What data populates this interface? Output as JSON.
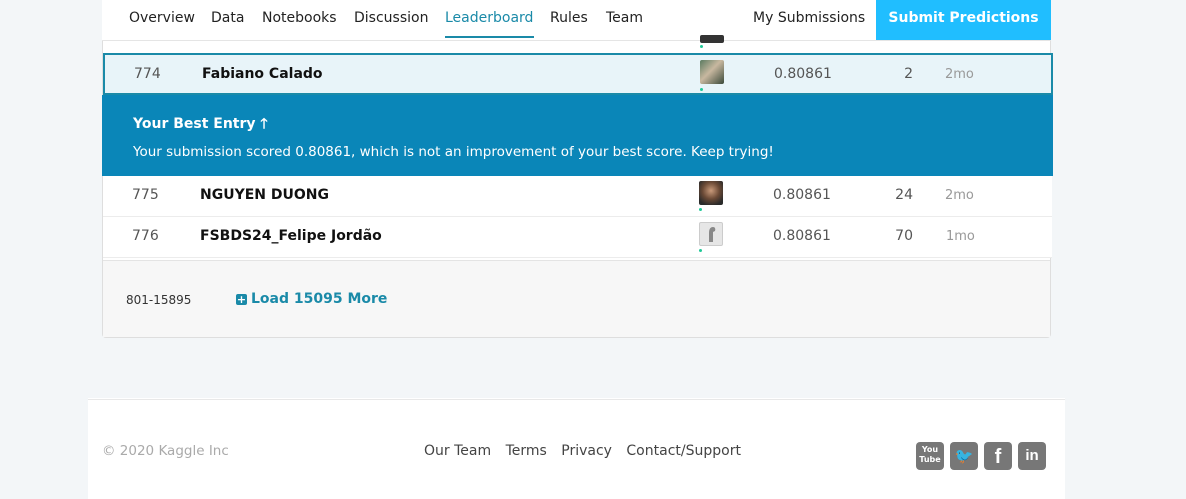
{
  "nav": {
    "tabs": [
      "Overview",
      "Data",
      "Notebooks",
      "Discussion",
      "Leaderboard",
      "Rules",
      "Team"
    ],
    "active_tab": "Leaderboard",
    "my_submissions": "My Submissions",
    "submit_predictions": "Submit Predictions"
  },
  "leaderboard": {
    "rows": [
      {
        "rank": "774",
        "team": "Fabiano Calado",
        "score": "0.80861",
        "entries": "2",
        "last": "2mo"
      },
      {
        "rank": "775",
        "team": "NGUYEN DUONG",
        "score": "0.80861",
        "entries": "24",
        "last": "2mo"
      },
      {
        "rank": "776",
        "team": "FSBDS24_Felipe Jordão",
        "score": "0.80861",
        "entries": "70",
        "last": "1mo"
      }
    ],
    "best_entry": {
      "title": "Your Best Entry ",
      "arrow": "🡑",
      "message": "Your submission scored 0.80861, which is not an improvement of your best score. Keep trying!"
    },
    "range": "801-15895",
    "load_more": "Load 15095 More"
  },
  "footer": {
    "copyright": "© 2020 Kaggle Inc",
    "links": [
      "Our Team",
      "Terms",
      "Privacy",
      "Contact/Support"
    ],
    "social": {
      "youtube": "You Tube",
      "twitter": "🐦",
      "facebook": "f",
      "linkedin": "in"
    }
  },
  "colors": {
    "accent": "#1a8aa8",
    "submit_button": "#20beff",
    "best_entry_banner": "#0a86b8",
    "social_icon": "#777777"
  }
}
